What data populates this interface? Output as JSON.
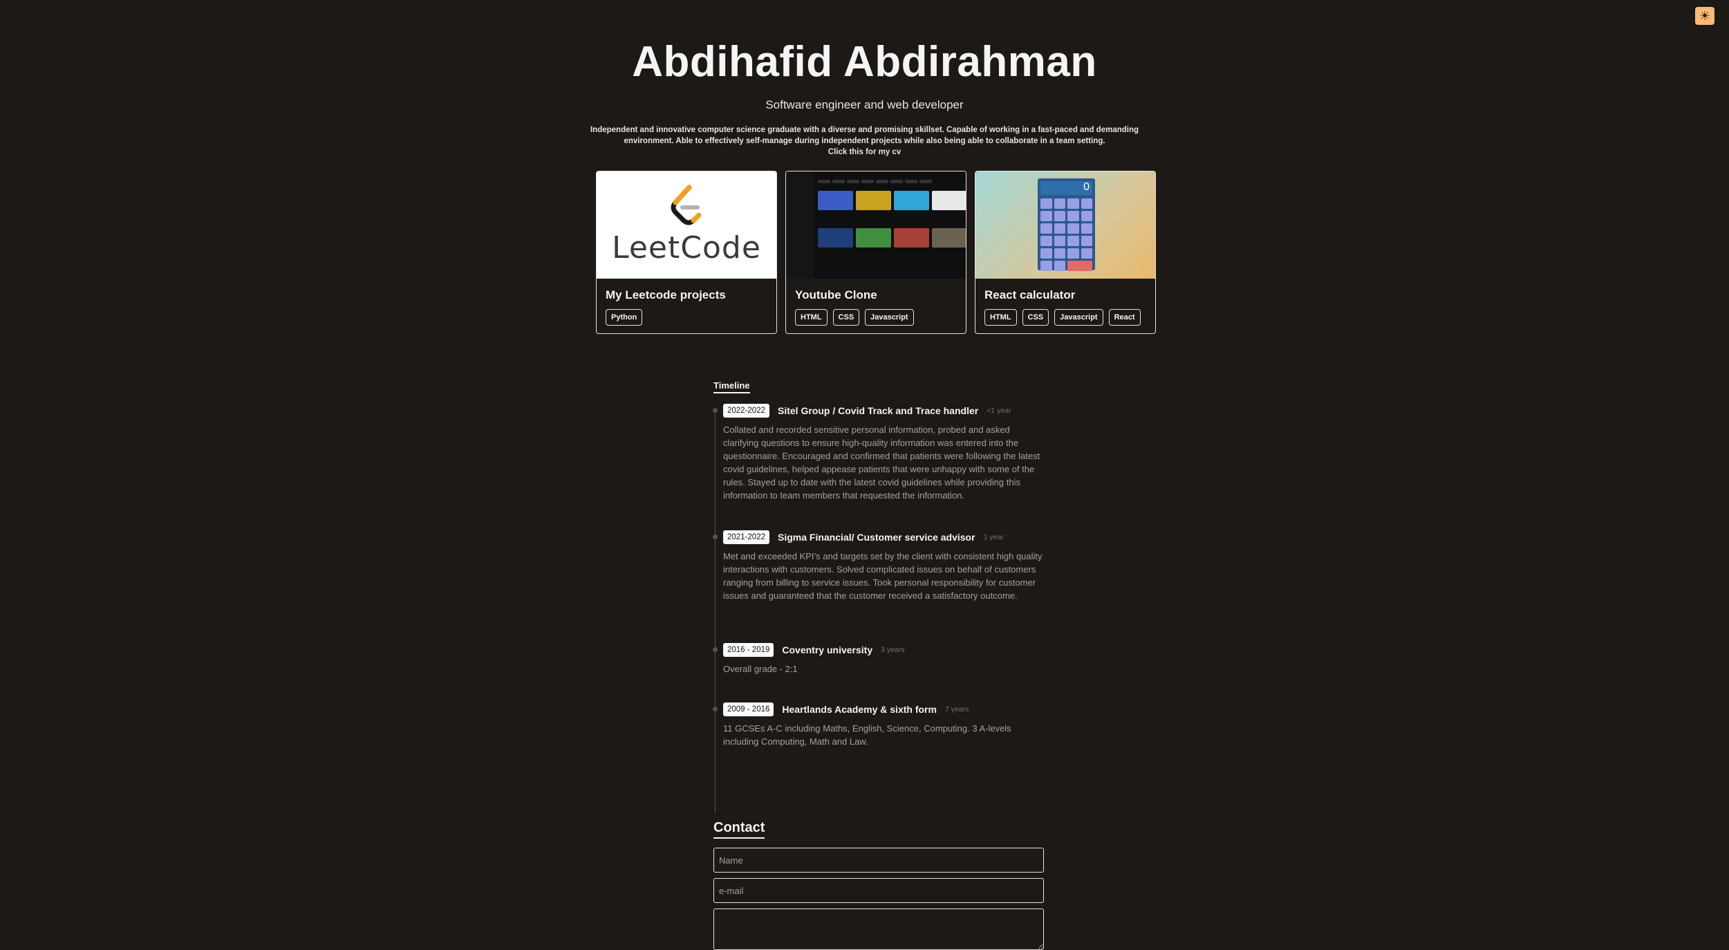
{
  "theme_toggle": {
    "icon": "sun-icon",
    "color": "#fdba74"
  },
  "header": {
    "name": "Abdihafid Abdirahman",
    "tagline": "Software engineer and web developer",
    "bio": "Independent and innovative computer science graduate with a diverse and promising skillset. Capable of working in a fast-paced and demanding environment. Able to effectively self-manage during independent projects while also being able to collaborate in a team setting.",
    "cv_link": "Click this for my cv"
  },
  "projects": [
    {
      "title": "My Leetcode projects",
      "thumb_text": "LeetCode",
      "tags": [
        "Python"
      ]
    },
    {
      "title": "Youtube Clone",
      "tags": [
        "HTML",
        "CSS",
        "Javascript"
      ]
    },
    {
      "title": "React calculator",
      "display": "0",
      "tags": [
        "HTML",
        "CSS",
        "Javascript",
        "React"
      ]
    }
  ],
  "timeline": {
    "heading": "Timeline",
    "items": [
      {
        "date": "2022-2022",
        "title": "Sitel Group / Covid Track and Trace handler",
        "duration": "<1 year",
        "description": "Collated and recorded sensitive personal information, probed and asked clarifying questions to ensure high-quality information was entered into the questionnaire. Encouraged and confirmed that patients were following the latest covid guidelines, helped appease patients that were unhappy with some of the rules. Stayed up to date with the latest covid guidelines while providing this information to team members that requested the information."
      },
      {
        "date": "2021-2022",
        "title": "Sigma Financial/ Customer service advisor",
        "duration": "1 year",
        "description": "Met and exceeded KPI’s and targets set by the client with consistent high quality interactions with customers. Solved complicated issues on behalf of customers ranging from billing to service issues. Took personal responsibility for customer issues and guaranteed that the customer received a satisfactory outcome."
      },
      {
        "date": "2016 - 2019",
        "title": "Coventry university",
        "duration": "3 years",
        "description": "Overall grade - 2:1"
      },
      {
        "date": "2009 - 2016",
        "title": "Heartlands Academy & sixth form",
        "duration": "7 years",
        "description": "11 GCSEs A-C including Maths, English, Science, Computing. 3 A-levels including Computing, Math and Law."
      }
    ]
  },
  "contact": {
    "heading": "Contact",
    "name_placeholder": "Name",
    "email_placeholder": "e-mail"
  }
}
